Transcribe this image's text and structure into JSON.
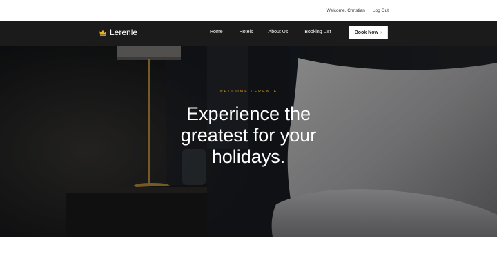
{
  "topbar": {
    "welcome_text": "Welcome, Christian",
    "logout_label": "Log Out"
  },
  "brand": {
    "name": "Lerenle",
    "icon": "crown-icon",
    "icon_color": "#e8b31a"
  },
  "nav": {
    "items": [
      {
        "label": "Home"
      },
      {
        "label": "Hotels"
      },
      {
        "label": "About Us"
      },
      {
        "label": "Booking List"
      }
    ],
    "book_button": "Book Now",
    "book_arrow": "›"
  },
  "hero": {
    "eyebrow": "WELCOME LERENLE",
    "headline": "Experience the greatest for your holidays.",
    "accent_color": "#d39c24"
  }
}
